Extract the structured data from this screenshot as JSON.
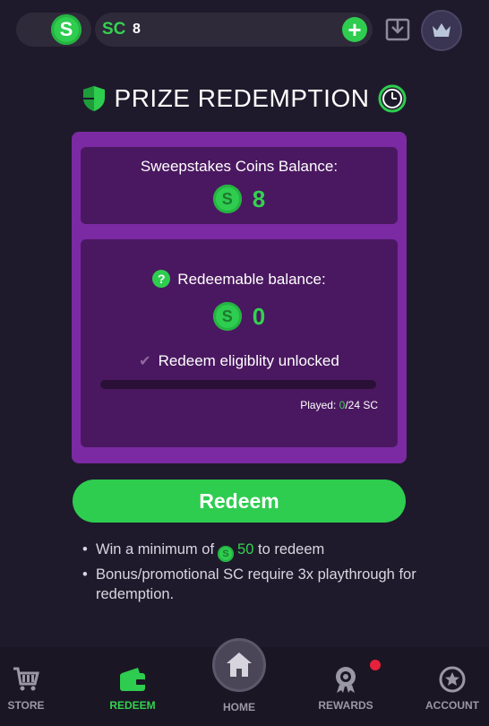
{
  "header": {
    "coin_icon_letter": "S",
    "sc_label": "SC",
    "sc_value": "8",
    "plus_icon": "+"
  },
  "title": {
    "text": "PRIZE REDEMPTION"
  },
  "card": {
    "sc_balance_label": "Sweepstakes Coins Balance:",
    "sc_balance_value": "8",
    "coin_letter": "S",
    "redeemable_label": "Redeemable balance:",
    "redeemable_help": "?",
    "redeemable_value": "0",
    "eligibility_label": "Redeem eligiblity unlocked",
    "played_prefix": "Played: ",
    "played_current": "0",
    "played_suffix": "/24 SC",
    "progress_fraction": 0
  },
  "redeem_button": {
    "label": "Redeem"
  },
  "notes": {
    "min_prefix": "Win a minimum of",
    "min_amount": "50",
    "min_suffix": "to redeem",
    "bonus_text": "Bonus/promotional SC require 3x playthrough for redemption."
  },
  "nav": {
    "store": "STORE",
    "redeem": "REDEEM",
    "home": "HOME",
    "rewards": "REWARDS",
    "account": "ACCOUNT"
  },
  "colors": {
    "accent_green": "#34d24f",
    "card_purple": "#7b2aa3",
    "panel_purple": "#4a1860",
    "background": "#1e1a2b",
    "notification_red": "#e8213a"
  }
}
